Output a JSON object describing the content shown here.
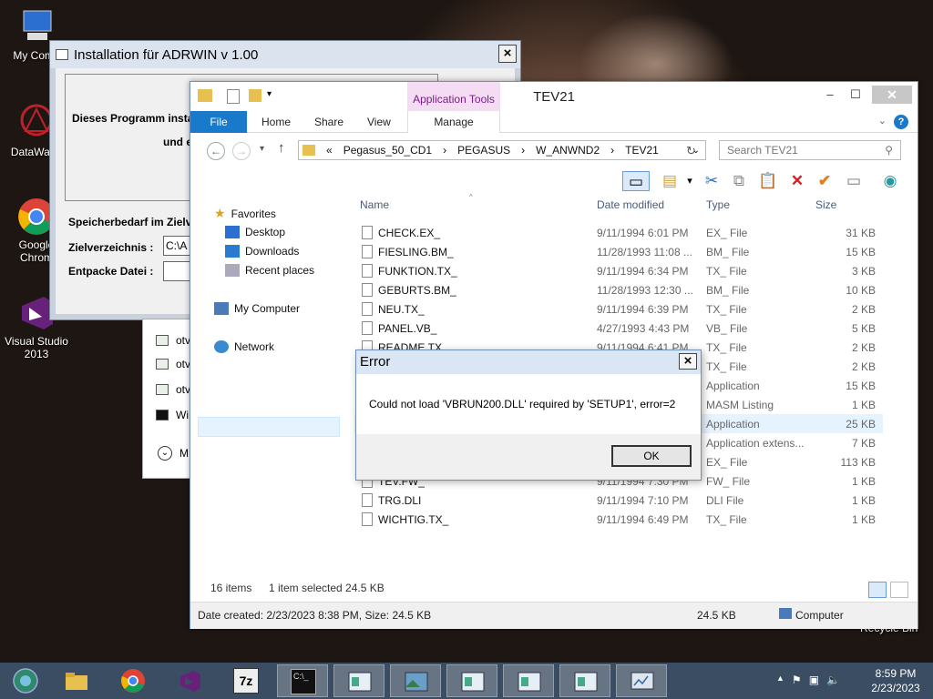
{
  "desktop": {
    "icons": [
      {
        "label": "My Comp"
      },
      {
        "label": "DataWage"
      },
      {
        "label": "Google Chrom"
      },
      {
        "label": "Visual Studio 2013"
      }
    ],
    "recycle_label": "Recycle Bin"
  },
  "installer": {
    "title": "Installation für ADRWIN v 1.00",
    "intro": "Dieses Programm instal",
    "intro2": "und e",
    "space_label": "Speicherbedarf im Zielv",
    "target_label": "Zielverzeichnis :",
    "target_value": "C:\\A",
    "unpack_label": "Entpacke Datei :",
    "unpack_value": ""
  },
  "behind_panel": {
    "items": [
      "otv",
      "otv",
      "otv",
      "Wi",
      "M"
    ]
  },
  "explorer": {
    "title": "TEV21",
    "app_tools": "Application Tools",
    "tabs": {
      "file": "File",
      "home": "Home",
      "share": "Share",
      "view": "View",
      "manage": "Manage"
    },
    "path": [
      "«",
      "Pegasus_50_CD1",
      "PEGASUS",
      "W_ANWND2",
      "TEV21"
    ],
    "search_placeholder": "Search TEV21",
    "nav": {
      "favorites": "Favorites",
      "desktop": "Desktop",
      "downloads": "Downloads",
      "recent": "Recent places",
      "computer": "My Computer",
      "network": "Network"
    },
    "columns": {
      "name": "Name",
      "date": "Date modified",
      "type": "Type",
      "size": "Size"
    },
    "files": [
      {
        "name": "CHECK.EX_",
        "date": "9/11/1994 6:01 PM",
        "type": "EX_ File",
        "size": "31 KB"
      },
      {
        "name": "FIESLING.BM_",
        "date": "11/28/1993 11:08 ...",
        "type": "BM_ File",
        "size": "15 KB"
      },
      {
        "name": "FUNKTION.TX_",
        "date": "9/11/1994 6:34 PM",
        "type": "TX_ File",
        "size": "3 KB"
      },
      {
        "name": "GEBURTS.BM_",
        "date": "11/28/1993 12:30 ...",
        "type": "BM_ File",
        "size": "10 KB"
      },
      {
        "name": "NEU.TX_",
        "date": "9/11/1994 6:39 PM",
        "type": "TX_ File",
        "size": "2 KB"
      },
      {
        "name": "PANEL.VB_",
        "date": "4/27/1993 4:43 PM",
        "type": "VB_ File",
        "size": "5 KB"
      },
      {
        "name": "README.TX",
        "date": "9/11/1994 6:41 PM",
        "type": "TX_ File",
        "size": "2 KB"
      },
      {
        "name": "",
        "date": "",
        "type": "TX_ File",
        "size": "2 KB"
      },
      {
        "name": "",
        "date": "",
        "type": "Application",
        "size": "15 KB"
      },
      {
        "name": "",
        "date": "",
        "type": "MASM Listing",
        "size": "1 KB"
      },
      {
        "name": "",
        "date": "",
        "type": "Application",
        "size": "25 KB"
      },
      {
        "name": "",
        "date": "",
        "type": "Application extens...",
        "size": "7 KB"
      },
      {
        "name": "",
        "date": "",
        "type": "EX_ File",
        "size": "113 KB"
      },
      {
        "name": "TEV.FW_",
        "date": "9/11/1994 7:30 PM",
        "type": "FW_ File",
        "size": "1 KB"
      },
      {
        "name": "TRG.DLI",
        "date": "9/11/1994 7:10 PM",
        "type": "DLI File",
        "size": "1 KB"
      },
      {
        "name": "WICHTIG.TX_",
        "date": "9/11/1994 6:49 PM",
        "type": "TX_ File",
        "size": "1 KB"
      }
    ],
    "status": {
      "count": "16 items",
      "selected": "1 item selected  24.5 KB"
    },
    "details": {
      "created": "Date created: 2/23/2023 8:38 PM, Size: 24.5 KB",
      "size": "24.5 KB",
      "location": "Computer"
    }
  },
  "dialog": {
    "title": "Error",
    "message": "Could not load 'VBRUN200.DLL' required by 'SETUP1', error=2",
    "ok": "OK"
  },
  "taskbar": {
    "time": "8:59 PM",
    "date": "2/23/2023",
    "buttons": [
      "start-icon",
      "file-explorer-icon",
      "chrome-icon",
      "visual-studio-icon",
      "7zip-icon",
      "cmd-icon",
      "window-icon",
      "photo-icon",
      "window-icon",
      "window-icon",
      "window-icon",
      "monitor-icon"
    ]
  }
}
